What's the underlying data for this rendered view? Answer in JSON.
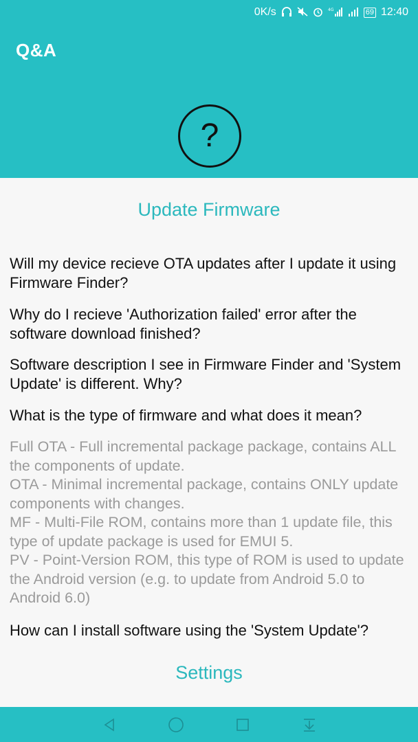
{
  "status_bar": {
    "speed": "0K/s",
    "network": "4G",
    "battery": "69",
    "time": "12:40"
  },
  "header": {
    "title": "Q&A",
    "icon": "question-mark-icon",
    "icon_glyph": "?"
  },
  "sections": [
    {
      "title": "Update Firmware",
      "questions": [
        {
          "text": "Will my device recieve OTA updates after I update it using Firmware Finder?"
        },
        {
          "text": "Why do I recieve 'Authorization failed' error after the software download finished?"
        },
        {
          "text": "Software description I see in Firmware Finder and 'System Update' is different. Why?"
        },
        {
          "text": "What is the type of firmware and what does it mean?",
          "answer": "Full OTA - Full incremental package package, contains ALL the components of update.\nOTA - Minimal incremental package, contains ONLY update components with changes.\nMF - Multi-File ROM, contains more than 1 update file, this type of update package is used for EMUI 5.\nPV - Point-Version ROM, this type of ROM is used to update the Android version (e.g. to update from Android 5.0 to Android 6.0)"
        },
        {
          "text": "How can I install software using the 'System Update'?"
        }
      ]
    },
    {
      "title": "Settings"
    }
  ],
  "colors": {
    "accent": "#26bfc4",
    "title_teal": "#2bb8bd",
    "answer_gray": "#9a9a9a"
  },
  "nav_bar": [
    "back-icon",
    "home-icon",
    "recents-icon",
    "notification-pull-icon"
  ]
}
